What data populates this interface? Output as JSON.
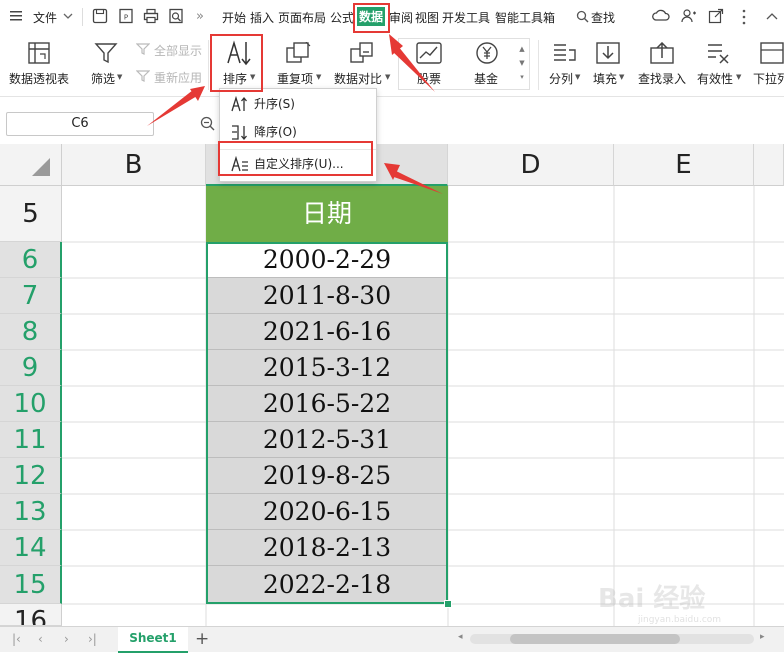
{
  "menubar": {
    "file": "文件",
    "tabs": [
      "开始",
      "插入",
      "页面布局",
      "公式",
      "数据",
      "审阅",
      "视图",
      "开发工具",
      "智能工具箱"
    ],
    "active_tab": "数据",
    "search": "查找"
  },
  "ribbon": {
    "pivot": "数据透视表",
    "filter": "筛选",
    "show_all": "全部显示",
    "reapply": "重新应用",
    "sort": "排序",
    "duplicate": "重复项",
    "compare": "数据对比",
    "stock": "股票",
    "fund": "基金",
    "split": "分列",
    "fill": "填充",
    "lookup": "查找录入",
    "validity": "有效性",
    "dropdown_list": "下拉列"
  },
  "namebox": "C6",
  "dropdown": {
    "asc": "升序(S)",
    "desc": "降序(O)",
    "custom": "自定义排序(U)..."
  },
  "grid": {
    "columns": [
      "B",
      "D",
      "E"
    ],
    "rows": [
      "5",
      "6",
      "7",
      "8",
      "9",
      "10",
      "11",
      "12",
      "13",
      "14",
      "15",
      "16"
    ],
    "header_cell": "日期",
    "dates": [
      "2000-2-29",
      "2011-8-30",
      "2021-6-16",
      "2015-3-12",
      "2016-5-22",
      "2012-5-31",
      "2019-8-25",
      "2020-6-15",
      "2018-2-13",
      "2022-2-18"
    ]
  },
  "sheet": {
    "name": "Sheet1"
  },
  "watermark": {
    "text": "Bai 经验",
    "sub": "jingyan.baidu.com"
  },
  "colors": {
    "accent": "#24a06a",
    "header_green": "#70ad47",
    "annotation_red": "#e53935"
  }
}
